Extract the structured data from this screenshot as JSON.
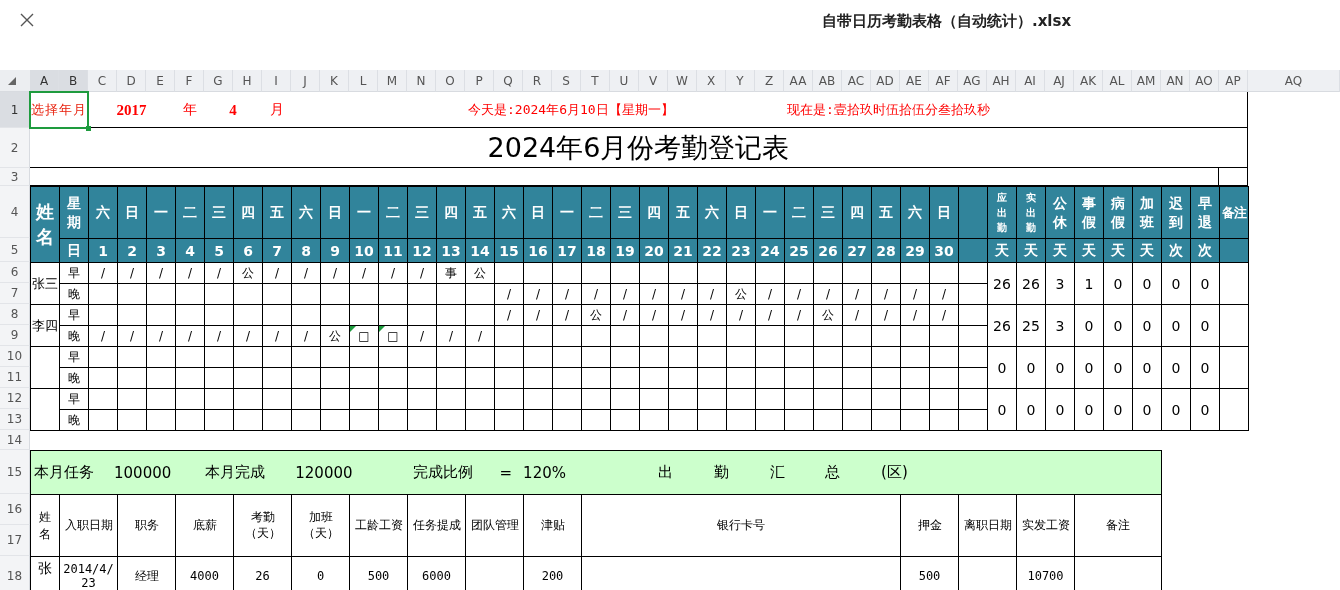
{
  "window": {
    "title": "自带日历考勤表格（自动统计）.xlsx"
  },
  "column_headers": [
    {
      "label": "A",
      "selected": true
    },
    {
      "label": "B",
      "selected": true
    },
    {
      "label": "C",
      "selected": false
    },
    {
      "label": "D",
      "selected": false
    },
    {
      "label": "E",
      "selected": false
    },
    {
      "label": "F",
      "selected": false
    },
    {
      "label": "G",
      "selected": false
    },
    {
      "label": "H",
      "selected": false
    },
    {
      "label": "I",
      "selected": false
    },
    {
      "label": "J",
      "selected": false
    },
    {
      "label": "K",
      "selected": false
    },
    {
      "label": "L",
      "selected": false
    },
    {
      "label": "M",
      "selected": false
    },
    {
      "label": "N",
      "selected": false
    },
    {
      "label": "O",
      "selected": false
    },
    {
      "label": "P",
      "selected": false
    },
    {
      "label": "Q",
      "selected": false
    },
    {
      "label": "R",
      "selected": false
    },
    {
      "label": "S",
      "selected": false
    },
    {
      "label": "T",
      "selected": false
    },
    {
      "label": "U",
      "selected": false
    },
    {
      "label": "V",
      "selected": false
    },
    {
      "label": "W",
      "selected": false
    },
    {
      "label": "X",
      "selected": false
    },
    {
      "label": "Y",
      "selected": false
    },
    {
      "label": "Z",
      "selected": false
    },
    {
      "label": "AA",
      "selected": false
    },
    {
      "label": "AB",
      "selected": false
    },
    {
      "label": "AC",
      "selected": false
    },
    {
      "label": "AD",
      "selected": false
    },
    {
      "label": "AE",
      "selected": false
    },
    {
      "label": "AF",
      "selected": false
    },
    {
      "label": "AG",
      "selected": false
    },
    {
      "label": "AH",
      "selected": false
    },
    {
      "label": "AI",
      "selected": false
    },
    {
      "label": "AJ",
      "selected": false
    },
    {
      "label": "AK",
      "selected": false
    },
    {
      "label": "AL",
      "selected": false
    },
    {
      "label": "AM",
      "selected": false
    },
    {
      "label": "AN",
      "selected": false
    },
    {
      "label": "AO",
      "selected": false
    },
    {
      "label": "AP",
      "selected": false
    },
    {
      "label": "AQ",
      "selected": false
    }
  ],
  "row_headers": [
    {
      "label": "1",
      "selected": true
    },
    {
      "label": "2",
      "selected": false
    },
    {
      "label": "3",
      "selected": false
    },
    {
      "label": "4",
      "selected": false
    },
    {
      "label": "5",
      "selected": false
    },
    {
      "label": "6",
      "selected": false
    },
    {
      "label": "7",
      "selected": false
    },
    {
      "label": "8",
      "selected": false
    },
    {
      "label": "9",
      "selected": false
    },
    {
      "label": "10",
      "selected": false
    },
    {
      "label": "11",
      "selected": false
    },
    {
      "label": "12",
      "selected": false
    },
    {
      "label": "13",
      "selected": false
    },
    {
      "label": "14",
      "selected": false
    },
    {
      "label": "15",
      "selected": false
    },
    {
      "label": "16",
      "selected": false
    },
    {
      "label": "17",
      "selected": false
    },
    {
      "label": "18",
      "selected": false
    }
  ],
  "date_picker": {
    "label": "选择年月",
    "selected": true,
    "year": "2017",
    "year_unit": "年",
    "month": "4",
    "month_unit": "月"
  },
  "today": "今天是:2024年6月10日【星期一】",
  "now": "现在是:壹拾玖时伍拾伍分叁拾玖秒",
  "title": "2024年6月份考勤登记表",
  "attendance": {
    "name_header": "姓名",
    "weekday_header": "星期",
    "date_header": "日",
    "remark_header": "备注",
    "days": [
      {
        "weekday": "六",
        "date": "1"
      },
      {
        "weekday": "日",
        "date": "2"
      },
      {
        "weekday": "一",
        "date": "3"
      },
      {
        "weekday": "二",
        "date": "4"
      },
      {
        "weekday": "三",
        "date": "5"
      },
      {
        "weekday": "四",
        "date": "6"
      },
      {
        "weekday": "五",
        "date": "7"
      },
      {
        "weekday": "六",
        "date": "8"
      },
      {
        "weekday": "日",
        "date": "9"
      },
      {
        "weekday": "一",
        "date": "10"
      },
      {
        "weekday": "二",
        "date": "11"
      },
      {
        "weekday": "三",
        "date": "12"
      },
      {
        "weekday": "四",
        "date": "13"
      },
      {
        "weekday": "五",
        "date": "14"
      },
      {
        "weekday": "六",
        "date": "15"
      },
      {
        "weekday": "日",
        "date": "16"
      },
      {
        "weekday": "一",
        "date": "17"
      },
      {
        "weekday": "二",
        "date": "18"
      },
      {
        "weekday": "三",
        "date": "19"
      },
      {
        "weekday": "四",
        "date": "20"
      },
      {
        "weekday": "五",
        "date": "21"
      },
      {
        "weekday": "六",
        "date": "22"
      },
      {
        "weekday": "日",
        "date": "23"
      },
      {
        "weekday": "一",
        "date": "24"
      },
      {
        "weekday": "二",
        "date": "25"
      },
      {
        "weekday": "三",
        "date": "26"
      },
      {
        "weekday": "四",
        "date": "27"
      },
      {
        "weekday": "五",
        "date": "28"
      },
      {
        "weekday": "六",
        "date": "29"
      },
      {
        "weekday": "日",
        "date": "30"
      }
    ],
    "stats": [
      {
        "label": "应出勤",
        "unit": "天"
      },
      {
        "label": "实出勤",
        "unit": "天"
      },
      {
        "label": "公休",
        "unit": "天"
      },
      {
        "label": "事假",
        "unit": "天"
      },
      {
        "label": "病假",
        "unit": "天"
      },
      {
        "label": "加班",
        "unit": "天"
      },
      {
        "label": "迟到",
        "unit": "次"
      },
      {
        "label": "早退",
        "unit": "次"
      }
    ],
    "employees": [
      {
        "name": "张三",
        "stats": [
          "26",
          "26",
          "3",
          "1",
          "0",
          "0",
          "0",
          "0"
        ],
        "shifts": [
          {
            "label": "早",
            "marks": [
              {
                "kind": "mark",
                "text": "/",
                "comment": false
              },
              {
                "kind": "mark",
                "text": "/",
                "comment": false
              },
              {
                "kind": "mark",
                "text": "/",
                "comment": false
              },
              {
                "kind": "mark",
                "text": "/",
                "comment": false
              },
              {
                "kind": "mark",
                "text": "/",
                "comment": false
              },
              {
                "kind": "mark",
                "text": "公",
                "comment": false
              },
              {
                "kind": "mark",
                "text": "/",
                "comment": false
              },
              {
                "kind": "mark",
                "text": "/",
                "comment": false
              },
              {
                "kind": "mark",
                "text": "/",
                "comment": false
              },
              {
                "kind": "mark",
                "text": "/",
                "comment": false
              },
              {
                "kind": "mark",
                "text": "/",
                "comment": false
              },
              {
                "kind": "mark",
                "text": "/",
                "comment": false
              },
              {
                "kind": "mark",
                "text": "事",
                "comment": false
              },
              {
                "kind": "mark",
                "text": "公",
                "comment": false
              },
              {
                "kind": "blank"
              },
              {
                "kind": "blank"
              },
              {
                "kind": "blank"
              },
              {
                "kind": "blank"
              },
              {
                "kind": "blank"
              },
              {
                "kind": "blank"
              },
              {
                "kind": "blank"
              },
              {
                "kind": "blank"
              },
              {
                "kind": "blank"
              },
              {
                "kind": "blank"
              },
              {
                "kind": "blank"
              },
              {
                "kind": "blank"
              },
              {
                "kind": "blank"
              },
              {
                "kind": "blank"
              },
              {
                "kind": "blank"
              },
              {
                "kind": "blank"
              }
            ]
          },
          {
            "label": "晚",
            "marks": [
              {
                "kind": "blank"
              },
              {
                "kind": "blank"
              },
              {
                "kind": "blank"
              },
              {
                "kind": "blank"
              },
              {
                "kind": "blank"
              },
              {
                "kind": "blank"
              },
              {
                "kind": "blank"
              },
              {
                "kind": "blank"
              },
              {
                "kind": "blank"
              },
              {
                "kind": "blank"
              },
              {
                "kind": "blank"
              },
              {
                "kind": "blank"
              },
              {
                "kind": "blank"
              },
              {
                "kind": "blank"
              },
              {
                "kind": "mark",
                "text": "/",
                "comment": false
              },
              {
                "kind": "mark",
                "text": "/",
                "comment": false
              },
              {
                "kind": "mark",
                "text": "/",
                "comment": false
              },
              {
                "kind": "mark",
                "text": "/",
                "comment": false
              },
              {
                "kind": "mark",
                "text": "/",
                "comment": false
              },
              {
                "kind": "mark",
                "text": "/",
                "comment": false
              },
              {
                "kind": "mark",
                "text": "/",
                "comment": false
              },
              {
                "kind": "mark",
                "text": "/",
                "comment": false
              },
              {
                "kind": "mark",
                "text": "公",
                "comment": false
              },
              {
                "kind": "mark",
                "text": "/",
                "comment": false
              },
              {
                "kind": "mark",
                "text": "/",
                "comment": false
              },
              {
                "kind": "mark",
                "text": "/",
                "comment": false
              },
              {
                "kind": "mark",
                "text": "/",
                "comment": false
              },
              {
                "kind": "mark",
                "text": "/",
                "comment": false
              },
              {
                "kind": "mark",
                "text": "/",
                "comment": false
              },
              {
                "kind": "mark",
                "text": "/",
                "comment": false
              }
            ]
          }
        ]
      },
      {
        "name": "李四",
        "stats": [
          "26",
          "25",
          "3",
          "0",
          "0",
          "0",
          "0",
          "0"
        ],
        "shifts": [
          {
            "label": "早",
            "marks": [
              {
                "kind": "blank"
              },
              {
                "kind": "blank"
              },
              {
                "kind": "blank"
              },
              {
                "kind": "blank"
              },
              {
                "kind": "blank"
              },
              {
                "kind": "blank"
              },
              {
                "kind": "blank"
              },
              {
                "kind": "blank"
              },
              {
                "kind": "blank"
              },
              {
                "kind": "blank"
              },
              {
                "kind": "blank"
              },
              {
                "kind": "blank"
              },
              {
                "kind": "blank"
              },
              {
                "kind": "blank"
              },
              {
                "kind": "mark",
                "text": "/",
                "comment": false
              },
              {
                "kind": "mark",
                "text": "/",
                "comment": false
              },
              {
                "kind": "mark",
                "text": "/",
                "comment": false
              },
              {
                "kind": "mark",
                "text": "公",
                "comment": false
              },
              {
                "kind": "mark",
                "text": "/",
                "comment": false
              },
              {
                "kind": "mark",
                "text": "/",
                "comment": false
              },
              {
                "kind": "mark",
                "text": "/",
                "comment": false
              },
              {
                "kind": "mark",
                "text": "/",
                "comment": false
              },
              {
                "kind": "mark",
                "text": "/",
                "comment": false
              },
              {
                "kind": "mark",
                "text": "/",
                "comment": false
              },
              {
                "kind": "mark",
                "text": "/",
                "comment": false
              },
              {
                "kind": "mark",
                "text": "公",
                "comment": false
              },
              {
                "kind": "mark",
                "text": "/",
                "comment": false
              },
              {
                "kind": "mark",
                "text": "/",
                "comment": false
              },
              {
                "kind": "mark",
                "text": "/",
                "comment": false
              },
              {
                "kind": "mark",
                "text": "/",
                "comment": false
              }
            ]
          },
          {
            "label": "晚",
            "marks": [
              {
                "kind": "mark",
                "text": "/",
                "comment": false
              },
              {
                "kind": "mark",
                "text": "/",
                "comment": false
              },
              {
                "kind": "mark",
                "text": "/",
                "comment": false
              },
              {
                "kind": "mark",
                "text": "/",
                "comment": false
              },
              {
                "kind": "mark",
                "text": "/",
                "comment": false
              },
              {
                "kind": "mark",
                "text": "/",
                "comment": false
              },
              {
                "kind": "mark",
                "text": "/",
                "comment": false
              },
              {
                "kind": "mark",
                "text": "/",
                "comment": false
              },
              {
                "kind": "mark",
                "text": "公",
                "comment": false
              },
              {
                "kind": "mark",
                "text": "□",
                "comment": true
              },
              {
                "kind": "mark",
                "text": "□",
                "comment": true
              },
              {
                "kind": "mark",
                "text": "/",
                "comment": false
              },
              {
                "kind": "mark",
                "text": "/",
                "comment": false
              },
              {
                "kind": "mark",
                "text": "/",
                "comment": false
              },
              {
                "kind": "blank"
              },
              {
                "kind": "blank"
              },
              {
                "kind": "blank"
              },
              {
                "kind": "blank"
              },
              {
                "kind": "blank"
              },
              {
                "kind": "blank"
              },
              {
                "kind": "blank"
              },
              {
                "kind": "blank"
              },
              {
                "kind": "blank"
              },
              {
                "kind": "blank"
              },
              {
                "kind": "blank"
              },
              {
                "kind": "blank"
              },
              {
                "kind": "blank"
              },
              {
                "kind": "blank"
              },
              {
                "kind": "blank"
              },
              {
                "kind": "blank"
              }
            ]
          }
        ]
      },
      {
        "stats": [
          "0",
          "0",
          "0",
          "0",
          "0",
          "0",
          "0",
          "0"
        ],
        "shifts": [
          {
            "label": "早"
          },
          {
            "label": "晚"
          }
        ]
      },
      {
        "stats": [
          "0",
          "0",
          "0",
          "0",
          "0",
          "0",
          "0",
          "0"
        ],
        "shifts": [
          {
            "label": "早"
          },
          {
            "label": "晚"
          }
        ]
      }
    ]
  },
  "payroll": {
    "task_label": "本月任务",
    "task": "100000",
    "done_label": "本月完成",
    "done": "120000",
    "ratio_label": "完成比例",
    "equals": "=",
    "ratio": "120%",
    "heading": "出 勤 汇 总 (区)",
    "columns": [
      "姓名",
      "入职日期",
      "职务",
      "底薪",
      "考勤（天）",
      "加班（天）",
      "工龄工资",
      "任务提成",
      "团队管理",
      "津贴",
      "银行卡号",
      "押金",
      "离职日期",
      "实发工资",
      "备注"
    ],
    "rows": [
      {
        "cells": [
          {
            "kind": "value",
            "text": "张"
          },
          {
            "kind": "value",
            "text": "2014/4/23"
          },
          {
            "kind": "value",
            "text": "经理"
          },
          {
            "kind": "value",
            "text": "4000"
          },
          {
            "kind": "value",
            "text": "26"
          },
          {
            "kind": "value",
            "text": "0"
          },
          {
            "kind": "value",
            "text": "500"
          },
          {
            "kind": "value",
            "text": "6000"
          },
          {
            "kind": "blank"
          },
          {
            "kind": "value",
            "text": "200"
          },
          {
            "kind": "blank"
          },
          {
            "kind": "value",
            "text": "500"
          },
          {
            "kind": "blank"
          },
          {
            "kind": "value",
            "text": "10700"
          },
          {
            "kind": "blank"
          }
        ]
      }
    ]
  }
}
